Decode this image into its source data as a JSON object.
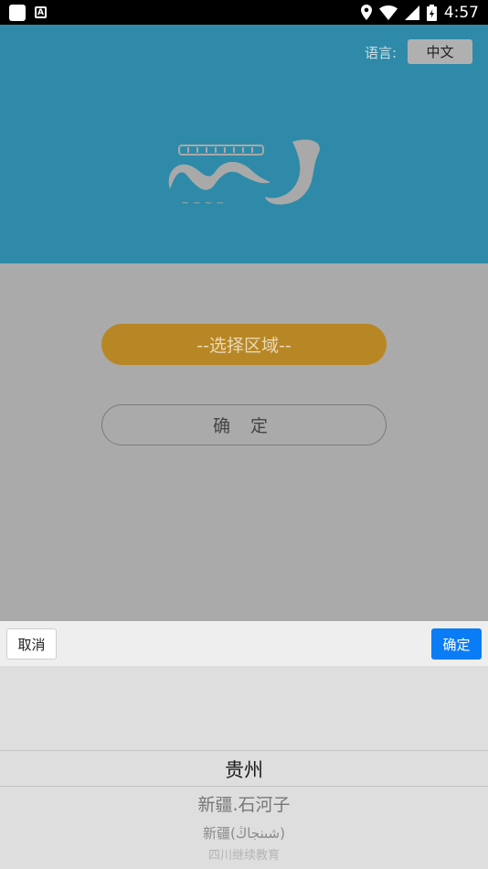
{
  "status_bar": {
    "time": "4:57"
  },
  "header": {
    "language_label": "语言:",
    "language_value": "中文"
  },
  "form": {
    "region_button": "--选择区域--",
    "confirm_button": "确 定"
  },
  "picker": {
    "cancel": "取消",
    "confirm": "确定",
    "options": [
      "贵州",
      "新疆.石河子",
      "新疆(شىنجاڭ)",
      "四川继续教育"
    ],
    "selected": "贵州"
  },
  "colors": {
    "header_bg": "#2e8aa8",
    "region_button_bg": "#b88725",
    "picker_confirm_bg": "#0a7cf5"
  }
}
